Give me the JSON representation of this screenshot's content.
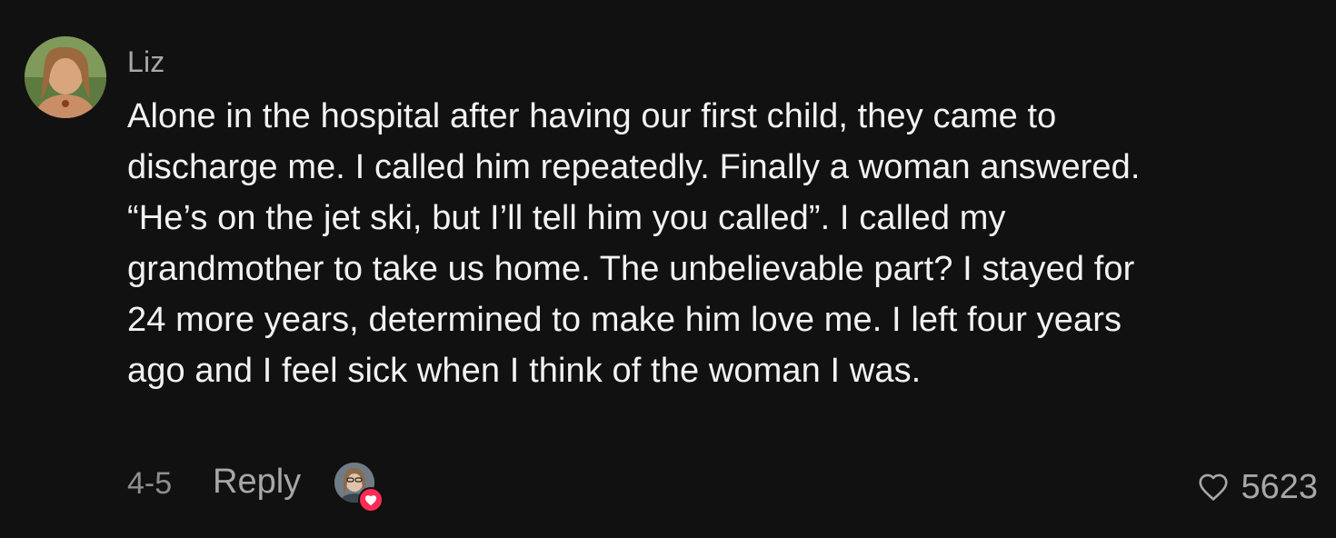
{
  "comment": {
    "username": "Liz",
    "text": "Alone in the hospital after having our first child, they came to discharge me. I called him repeatedly. Finally a woman answered. “He’s on the jet ski, but I’ll tell him you called”. I called my grandmother to take us home. The unbelievable part? I stayed for 24 more years, determined to make him love me. I left four years ago and I feel sick when I think of the woman I was.",
    "date": "4-5",
    "reply_label": "Reply",
    "like_count": "5623"
  },
  "icons": {
    "like": "heart-outline-icon",
    "creator_liked_badge": "heart-icon"
  },
  "colors": {
    "background": "#111111",
    "text": "#f2f2f2",
    "muted": "#a7a7a7",
    "badge": "#fe2c55"
  }
}
